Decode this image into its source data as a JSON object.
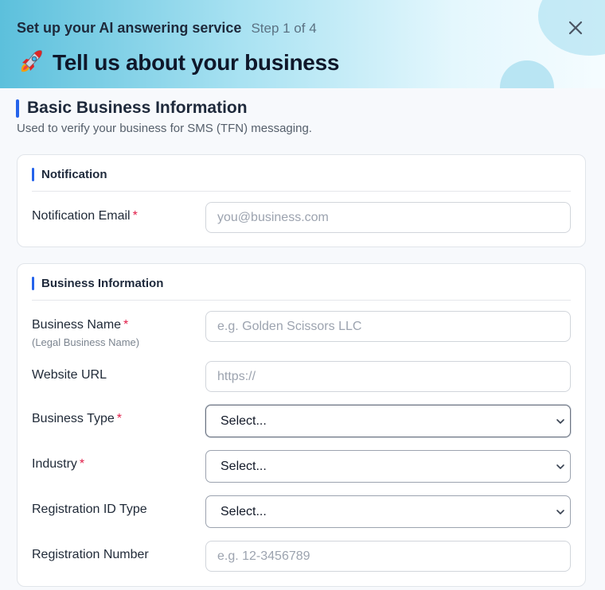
{
  "header": {
    "setup_title": "Set up your AI answering service",
    "step": "Step 1 of 4",
    "main_title": "Tell us about your business"
  },
  "section": {
    "title": "Basic Business Information",
    "description": "Used to verify your business for SMS (TFN) messaging."
  },
  "notification": {
    "title": "Notification",
    "email_label": "Notification Email",
    "required_mark": "*",
    "email_placeholder": "you@business.com"
  },
  "business": {
    "title": "Business Information",
    "required_mark": "*",
    "name_label": "Business Name",
    "name_sublabel": "(Legal Business Name)",
    "name_placeholder": "e.g. Golden Scissors LLC",
    "website_label": "Website URL",
    "website_placeholder": "https://",
    "type_label": "Business Type",
    "type_value": "Select...",
    "industry_label": "Industry",
    "industry_value": "Select...",
    "regid_label": "Registration ID Type",
    "regid_value": "Select...",
    "regnum_label": "Registration Number",
    "regnum_placeholder": "e.g. 12-3456789"
  },
  "colors": {
    "accent": "#2563eb",
    "required": "#e11d48"
  },
  "icons": {
    "close": "close-icon",
    "rocket": "rocket-icon",
    "chevron": "chevron-down-icon"
  }
}
